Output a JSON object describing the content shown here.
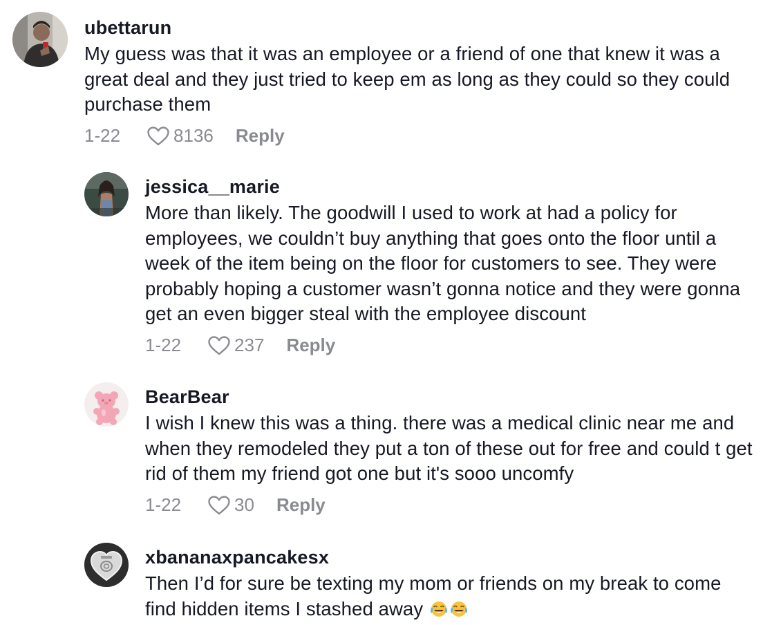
{
  "comments": [
    {
      "username": "ubettarun",
      "avatar": "man-mirror-selfie-avatar",
      "text": "My guess was that it was an employee or a friend of one that knew it was a great deal and they just tried to keep em as long as they could so they could purchase them",
      "date": "1-22",
      "likes": "8136",
      "reply_label": "Reply"
    },
    {
      "username": "jessica__marie",
      "avatar": "woman-photo-avatar",
      "text": "More than likely. The goodwill I used to work at had a policy for employees, we couldn’t buy anything that goes onto the floor until a week of the item being on the floor for customers to see. They were probably hoping a customer wasn’t gonna notice and they were gonna get an even bigger steal with the employee discount",
      "date": "1-22",
      "likes": "237",
      "reply_label": "Reply"
    },
    {
      "username": "BearBear",
      "avatar": "pink-gummy-bear-avatar",
      "text": "I wish I knew this was a thing. there was a medical clinic near me and when they remodeled they put a ton of these out for free and could t get rid of them my friend got one but it's sooo uncomfy",
      "date": "1-22",
      "likes": "30",
      "reply_label": "Reply"
    },
    {
      "username": "xbananaxpancakesx",
      "avatar": "heart-candy-avatar",
      "text": "Then I’d for sure be texting my mom or friends on my break to come find hidden items I stashed away",
      "emoji": "😂😂",
      "emoji_name": "tears-of-joy"
    }
  ],
  "colors": {
    "text": "#161823",
    "meta": "#8a8b91",
    "background": "#ffffff"
  }
}
